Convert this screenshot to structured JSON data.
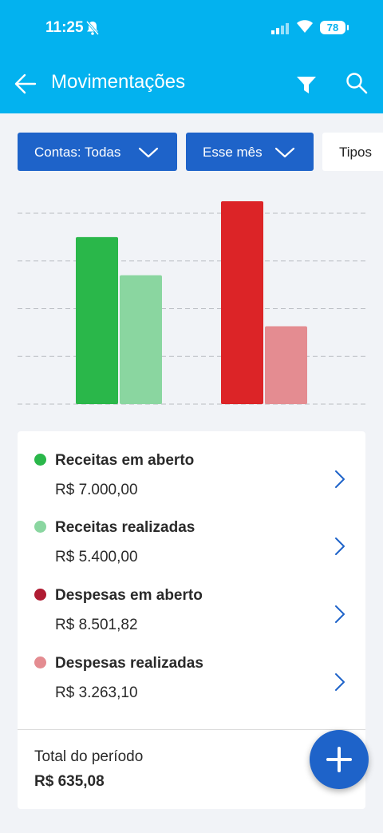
{
  "status": {
    "time": "11:25",
    "battery": "78"
  },
  "header": {
    "title": "Movimentações"
  },
  "filters": {
    "contas": "Contas: Todas",
    "periodo": "Esse mês",
    "tipos": "Tipos"
  },
  "colors": {
    "receitas_aberto": "#2ab74a",
    "receitas_realizadas": "#8ad6a0",
    "despesas_aberto": "#dc2427",
    "despesas_realizadas": "#e48c91",
    "despesas_dot": "#b01c33",
    "primary": "#1e63c9",
    "appbar": "#03b2ef"
  },
  "chart_data": {
    "type": "bar",
    "series": [
      {
        "name": "Receitas em aberto",
        "value": 7000.0,
        "color": "#2ab74a"
      },
      {
        "name": "Receitas realizadas",
        "value": 5400.0,
        "color": "#8ad6a0"
      },
      {
        "name": "Despesas em aberto",
        "value": 8501.82,
        "color": "#dc2427"
      },
      {
        "name": "Despesas realizadas",
        "value": 3263.1,
        "color": "#e48c91"
      }
    ],
    "grid": true,
    "ylim": [
      0,
      8501.82
    ]
  },
  "summary": {
    "items": [
      {
        "label": "Receitas em aberto",
        "value": "R$ 7.000,00"
      },
      {
        "label": "Receitas realizadas",
        "value": "R$ 5.400,00"
      },
      {
        "label": "Despesas em aberto",
        "value": "R$ 8.501,82"
      },
      {
        "label": "Despesas realizadas",
        "value": "R$ 3.263,10"
      }
    ],
    "total_label": "Total do período",
    "total_value": "R$ 635,08"
  },
  "icons": {
    "back": "arrow-left-icon",
    "filter": "filter-icon",
    "search": "search-icon",
    "chevron": "chevron-right-icon",
    "add": "plus-icon"
  }
}
